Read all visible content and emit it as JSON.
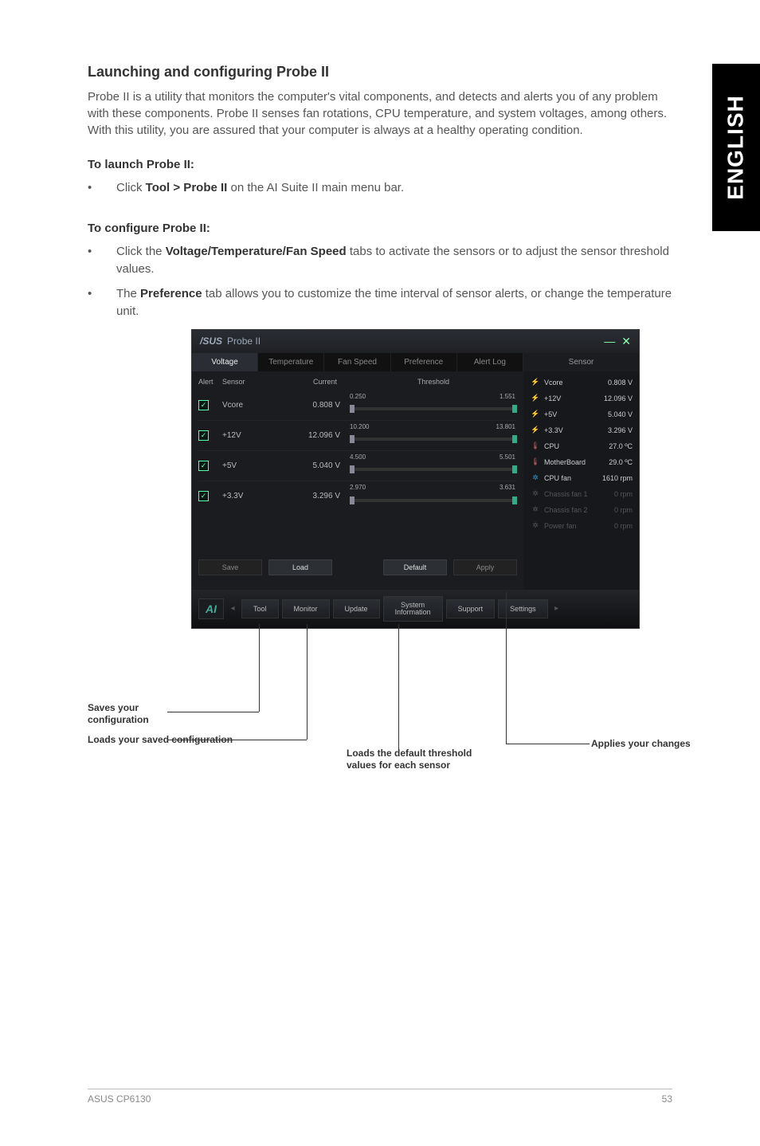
{
  "sideTab": "ENGLISH",
  "heading": "Launching and configuring Probe II",
  "intro": "Probe II is a utility that monitors the computer's vital components, and detects and alerts you of any problem with these components. Probe II senses fan rotations, CPU temperature, and system voltages, among others. With this utility, you are assured that your computer is always at a healthy operating condition.",
  "launch": {
    "head": "To launch Probe II:",
    "bullet_pre": "Click ",
    "bullet_bold": "Tool > Probe II",
    "bullet_post": " on the AI Suite II main menu bar."
  },
  "configure": {
    "head": "To configure Probe II:",
    "b1_pre": "Click the ",
    "b1_bold": "Voltage/Temperature/Fan Speed",
    "b1_post": " tabs to activate the sensors or to adjust the sensor threshold values.",
    "b2_pre": "The ",
    "b2_bold": "Preference",
    "b2_post": " tab allows you to customize the time interval of sensor alerts, or change the temperature unit."
  },
  "app": {
    "title": "Probe II",
    "tabs": {
      "voltage": "Voltage",
      "temperature": "Temperature",
      "fanspeed": "Fan Speed",
      "preference": "Preference",
      "alertlog": "Alert Log",
      "sensor": "Sensor"
    },
    "headers": {
      "alert": "Alert",
      "sensor": "Sensor",
      "current": "Current",
      "threshold": "Threshold"
    },
    "rows": [
      {
        "name": "Vcore",
        "value": "0.808 V",
        "low": "0.250",
        "high": "1.551"
      },
      {
        "name": "+12V",
        "value": "12.096 V",
        "low": "10.200",
        "high": "13.801"
      },
      {
        "name": "+5V",
        "value": "5.040 V",
        "low": "4.500",
        "high": "5.501"
      },
      {
        "name": "+3.3V",
        "value": "3.296 V",
        "low": "2.970",
        "high": "3.631"
      }
    ],
    "buttons": {
      "save": "Save",
      "load": "Load",
      "default": "Default",
      "apply": "Apply"
    },
    "sensors": [
      {
        "icon": "⚡",
        "cls": "si-bolt",
        "name": "Vcore",
        "val": "0.808 V"
      },
      {
        "icon": "⚡",
        "cls": "si-bolt",
        "name": "+12V",
        "val": "12.096 V"
      },
      {
        "icon": "⚡",
        "cls": "si-bolt",
        "name": "+5V",
        "val": "5.040 V"
      },
      {
        "icon": "⚡",
        "cls": "si-bolt",
        "name": "+3.3V",
        "val": "3.296 V"
      },
      {
        "icon": "🌡",
        "cls": "si-temp",
        "name": "CPU",
        "val": "27.0 ºC"
      },
      {
        "icon": "🌡",
        "cls": "si-temp",
        "name": "MotherBoard",
        "val": "29.0 ºC"
      },
      {
        "icon": "✲",
        "cls": "si-fan",
        "name": "CPU fan",
        "val": "1610 rpm"
      },
      {
        "icon": "✲",
        "cls": "si-dim",
        "name": "Chassis fan 1",
        "val": "0 rpm"
      },
      {
        "icon": "✲",
        "cls": "si-dim",
        "name": "Chassis fan 2",
        "val": "0 rpm"
      },
      {
        "icon": "✲",
        "cls": "si-dim",
        "name": "Power fan",
        "val": "0 rpm"
      }
    ],
    "bottom": {
      "tool": "Tool",
      "monitor": "Monitor",
      "update": "Update",
      "sysinfo": "System\nInformation",
      "support": "Support",
      "settings": "Settings"
    }
  },
  "callouts": {
    "saves": "Saves your configuration",
    "loads": "Loads your saved configuration",
    "defaults": "Loads the default threshold values for each sensor",
    "applies": "Applies your changes"
  },
  "footer": {
    "left": "ASUS CP6130",
    "right": "53"
  }
}
